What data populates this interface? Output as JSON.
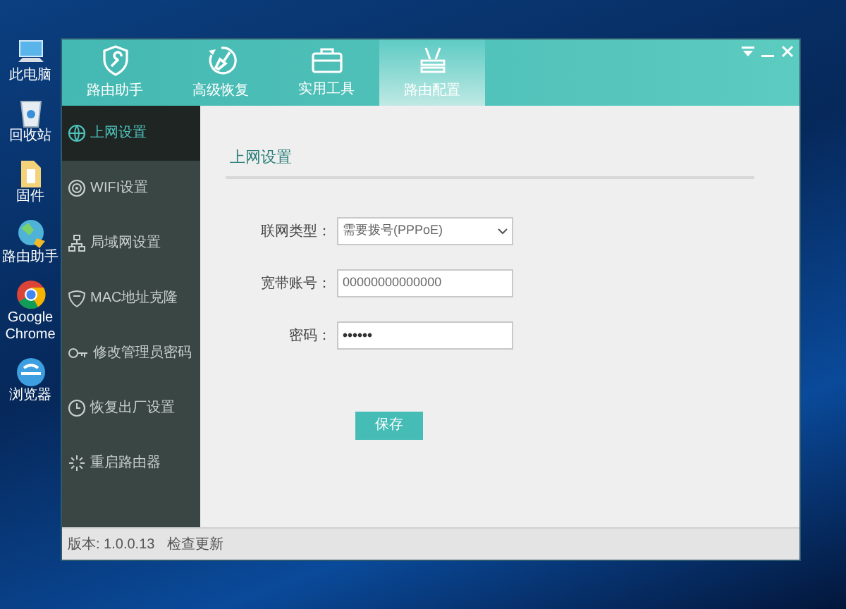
{
  "desktop_icons": [
    {
      "label": "此电脑"
    },
    {
      "label": "回收站"
    },
    {
      "label": "固件"
    },
    {
      "label": "路由助手"
    },
    {
      "label": "Google Chrome"
    },
    {
      "label": "浏览器"
    }
  ],
  "tabs": [
    {
      "label": "路由助手",
      "selected": false
    },
    {
      "label": "高级恢复",
      "selected": false
    },
    {
      "label": "实用工具",
      "selected": false
    },
    {
      "label": "路由配置",
      "selected": true
    }
  ],
  "sidebar": {
    "items": [
      {
        "label": "上网设置",
        "selected": true
      },
      {
        "label": "WIFI设置",
        "selected": false
      },
      {
        "label": "局域网设置",
        "selected": false
      },
      {
        "label": "MAC地址克隆",
        "selected": false
      },
      {
        "label": "修改管理员密码",
        "selected": false
      },
      {
        "label": "恢复出厂设置",
        "selected": false
      },
      {
        "label": "重启路由器",
        "selected": false
      }
    ]
  },
  "panel": {
    "title": "上网设置",
    "fields": [
      {
        "label": "联网类型：",
        "kind": "select",
        "value": "需要拨号(PPPoE)"
      },
      {
        "label": "宽带账号：",
        "kind": "text",
        "value": "00000000000000"
      },
      {
        "label": "密码：",
        "kind": "password",
        "value": "••••••"
      }
    ],
    "save_button": "保存"
  },
  "status_bar": {
    "version": "版本: 1.0.0.13",
    "update_link": "检查更新"
  }
}
